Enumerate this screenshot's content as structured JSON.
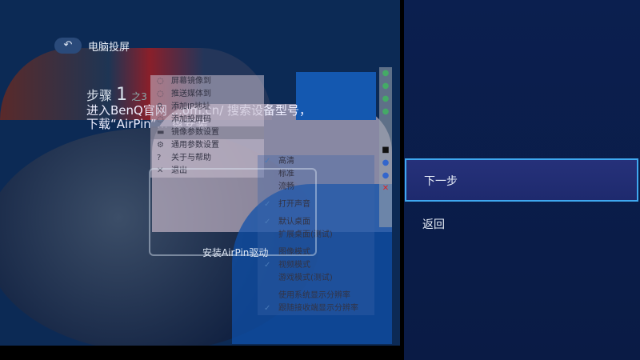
{
  "header": {
    "back_icon": "↶",
    "title": "电脑投屏"
  },
  "step": {
    "label": "步骤",
    "number": "1",
    "total": "之3"
  },
  "description": {
    "line1": "进入BenQ官网 ...om.cn/ 搜索设备型号，",
    "line2": "下载“AirPin”... 盘安装"
  },
  "menu": {
    "items": [
      "屏幕镜像到",
      "推送媒体到",
      "添加IP地址",
      "添加投屏码",
      "镜像参数设置",
      "通用参数设置",
      "关于与帮助",
      "退出"
    ]
  },
  "submenu": {
    "items": [
      "高清",
      "标准",
      "流畅",
      "打开声音",
      "默认桌面",
      "扩展桌面(测试)",
      "图像模式",
      "视频模式",
      "游戏模式(测试)",
      "使用系统显示分辨率",
      "跟随接收端显示分辨率"
    ]
  },
  "install_label": "安装AirPin驱动",
  "right_menu": {
    "next": "下一步",
    "back": "返回"
  },
  "colors": {
    "focus_border": "#3fa8f0",
    "panel_bg": "#0b1f4f"
  }
}
